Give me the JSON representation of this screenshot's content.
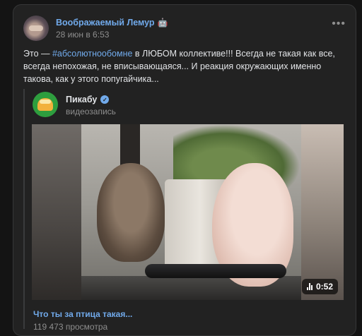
{
  "post": {
    "author": "Воображаемый Лемур",
    "author_badge_icon": "bot-icon",
    "date": "28 июн в 6:53",
    "more_icon": "more-horizontal-icon",
    "text_prefix": "Это — ",
    "hashtag": "#абсолютнообомне",
    "text_body": " в ЛЮБОМ коллективе!!! Всегда не такая как все, всегда непохожая, не вписывающаяся... И реакция окружающих именно такова, как у этого попугайчика..."
  },
  "repost": {
    "source_name": "Пикабу",
    "verified_icon": "verified-check-icon",
    "source_subtitle": "видеозапись",
    "video": {
      "duration": "0:52",
      "title": "Что ты за птица такая...",
      "views": "119 473 просмотра"
    }
  },
  "colors": {
    "link": "#71aaeb",
    "background": "#222222",
    "text": "#e1e3e6",
    "muted": "#8e8e8e"
  }
}
